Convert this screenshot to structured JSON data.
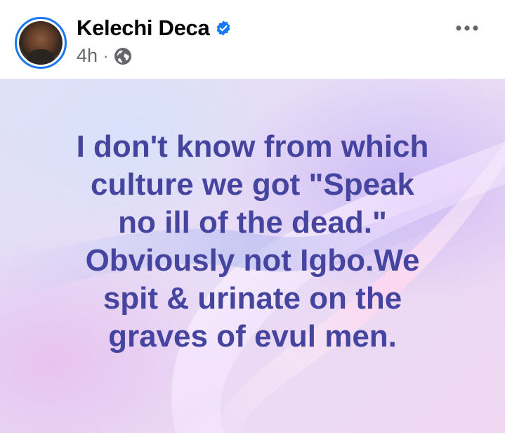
{
  "author": {
    "name": "Kelechi Deca",
    "verified": true,
    "verified_icon": "verified-badge-icon",
    "avatar_icon": "profile-photo"
  },
  "meta": {
    "time": "4h",
    "separator": "·",
    "audience_icon": "globe-icon"
  },
  "menu": {
    "icon": "more-options-icon"
  },
  "post": {
    "lines": [
      "I don't know from which",
      "culture we got \"Speak",
      "no ill of the dead.\"",
      "Obviously not Igbo.We",
      "spit & urinate on the",
      "graves of evul men."
    ],
    "text_color": "#4545a0",
    "background": "pastel-lavender-swirl"
  },
  "colors": {
    "accent": "#1877f2",
    "name": "#050505",
    "meta": "#65676b"
  }
}
